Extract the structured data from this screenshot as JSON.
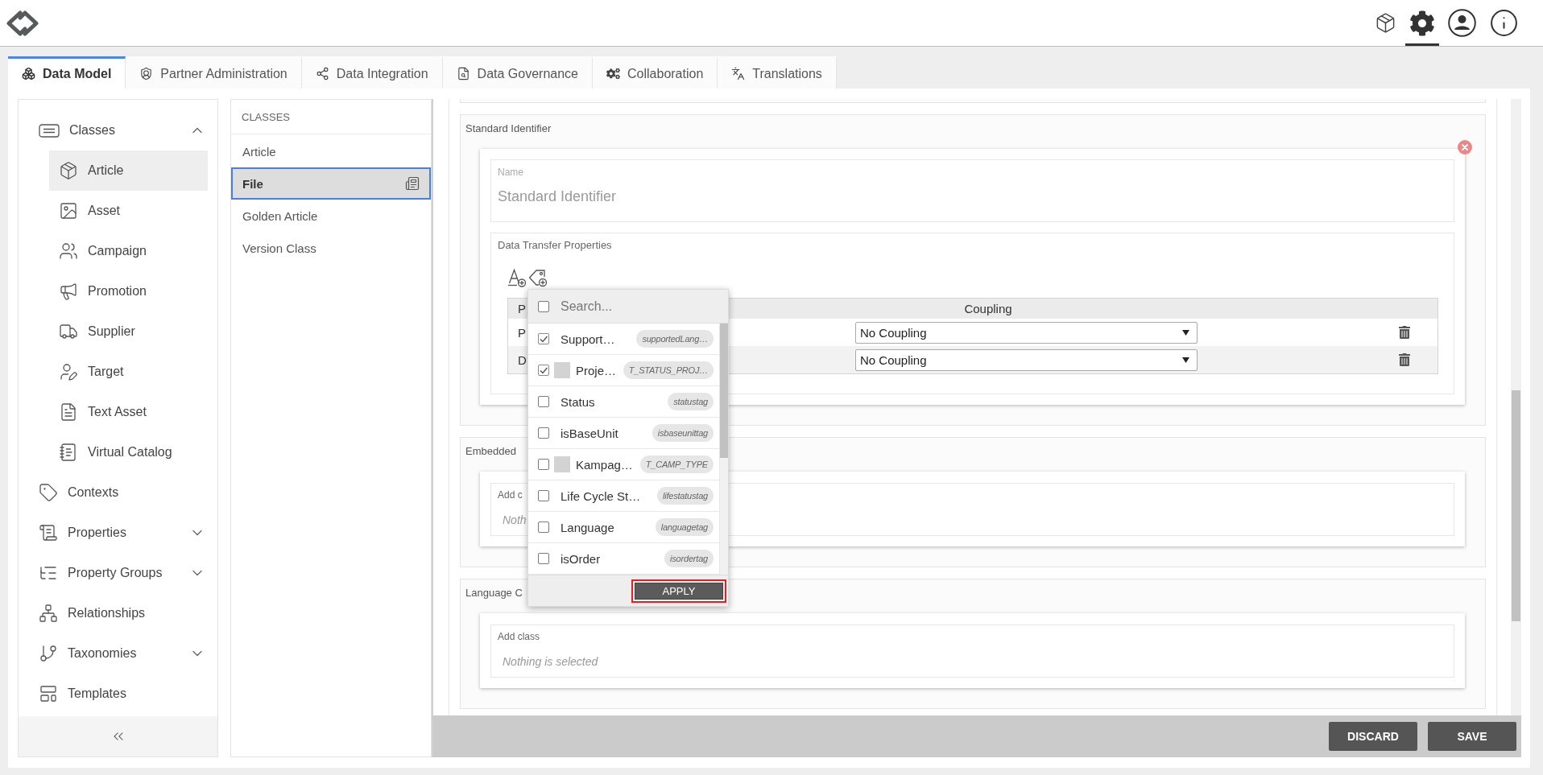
{
  "header": {
    "actions": [
      {
        "kind": "package",
        "selected": false
      },
      {
        "kind": "settings",
        "selected": true
      },
      {
        "kind": "account",
        "selected": false
      },
      {
        "kind": "info",
        "selected": false
      }
    ]
  },
  "tabs": [
    {
      "label": "Data Model",
      "kind": "model",
      "selected": true
    },
    {
      "label": "Partner Administration",
      "kind": "partner",
      "selected": false
    },
    {
      "label": "Data Integration",
      "kind": "integration",
      "selected": false
    },
    {
      "label": "Data Governance",
      "kind": "governance",
      "selected": false
    },
    {
      "label": "Collaboration",
      "kind": "collaboration",
      "selected": false
    },
    {
      "label": "Translations",
      "kind": "translation",
      "selected": false
    }
  ],
  "sidebar": {
    "items": [
      {
        "label": "Classes",
        "kind": "classes",
        "selected": false,
        "expanded": true,
        "children": [
          {
            "label": "Article",
            "kind": "article",
            "selected": true
          },
          {
            "label": "Asset",
            "kind": "asset",
            "selected": false
          },
          {
            "label": "Campaign",
            "kind": "campaign",
            "selected": false
          },
          {
            "label": "Promotion",
            "kind": "promotion",
            "selected": false
          },
          {
            "label": "Supplier",
            "kind": "supplier",
            "selected": false
          },
          {
            "label": "Target",
            "kind": "target",
            "selected": false
          },
          {
            "label": "Text Asset",
            "kind": "text",
            "selected": false
          },
          {
            "label": "Virtual Catalog",
            "kind": "catalog",
            "selected": false
          }
        ]
      },
      {
        "label": "Contexts",
        "kind": "contexts",
        "selected": false
      },
      {
        "label": "Properties",
        "kind": "properties",
        "selected": false,
        "expanded": false
      },
      {
        "label": "Property Groups",
        "kind": "groups",
        "selected": false,
        "expanded": false
      },
      {
        "label": "Relationships",
        "kind": "relationships",
        "selected": false
      },
      {
        "label": "Taxonomies",
        "kind": "taxonomies",
        "selected": false,
        "expanded": false
      },
      {
        "label": "Templates",
        "kind": "templates",
        "selected": false
      }
    ]
  },
  "class_list": {
    "title": "CLASSES",
    "items": [
      {
        "label": "Article",
        "selected": false
      },
      {
        "label": "File",
        "selected": true
      },
      {
        "label": "Golden Article",
        "selected": false
      },
      {
        "label": "Version Class",
        "selected": false
      }
    ]
  },
  "sections": [
    {
      "kind": "identifier",
      "title": "Standard Identifier",
      "removable": true,
      "name_field": {
        "label": "Name",
        "value": "Standard Identifier"
      },
      "transfer": {
        "label": "Data Transfer Properties",
        "columns": [
          "P",
          "Coupling"
        ],
        "rows": [
          {
            "property": "P",
            "coupling": "No Coupling"
          },
          {
            "property": "D",
            "coupling": "No Coupling"
          }
        ]
      }
    },
    {
      "kind": "class_picker",
      "title": "Embedded",
      "field": {
        "label": "Add c",
        "selection": "Noth"
      }
    },
    {
      "kind": "class_picker",
      "title": "Language C",
      "field": {
        "label": "Add class",
        "selection": "Nothing is selected"
      }
    }
  ],
  "picker": {
    "select_all": {
      "checked": false
    },
    "search": {
      "placeholder": "Search..."
    },
    "items": [
      {
        "label": "Support…",
        "tag": "supportedLang…",
        "checked": true
      },
      {
        "label": "Proje…",
        "tag": "T_STATUS_PROJ…",
        "checked": true,
        "color": "#d3d3d3"
      },
      {
        "label": "Status",
        "tag": "statustag",
        "checked": false
      },
      {
        "label": "isBaseUnit",
        "tag": "isbaseunittag",
        "checked": false
      },
      {
        "label": "Kampag…",
        "tag": "T_CAMP_TYPE",
        "checked": false,
        "color": "#d3d3d3"
      },
      {
        "label": "Life Cycle St…",
        "tag": "lifestatustag",
        "checked": false
      },
      {
        "label": "Language",
        "tag": "languagetag",
        "checked": false
      },
      {
        "label": "isOrder",
        "tag": "isordertag",
        "checked": false
      }
    ],
    "apply": {
      "label": "APPLY",
      "focused": true
    }
  },
  "actions": [
    {
      "label": "DISCARD"
    },
    {
      "label": "SAVE"
    }
  ]
}
